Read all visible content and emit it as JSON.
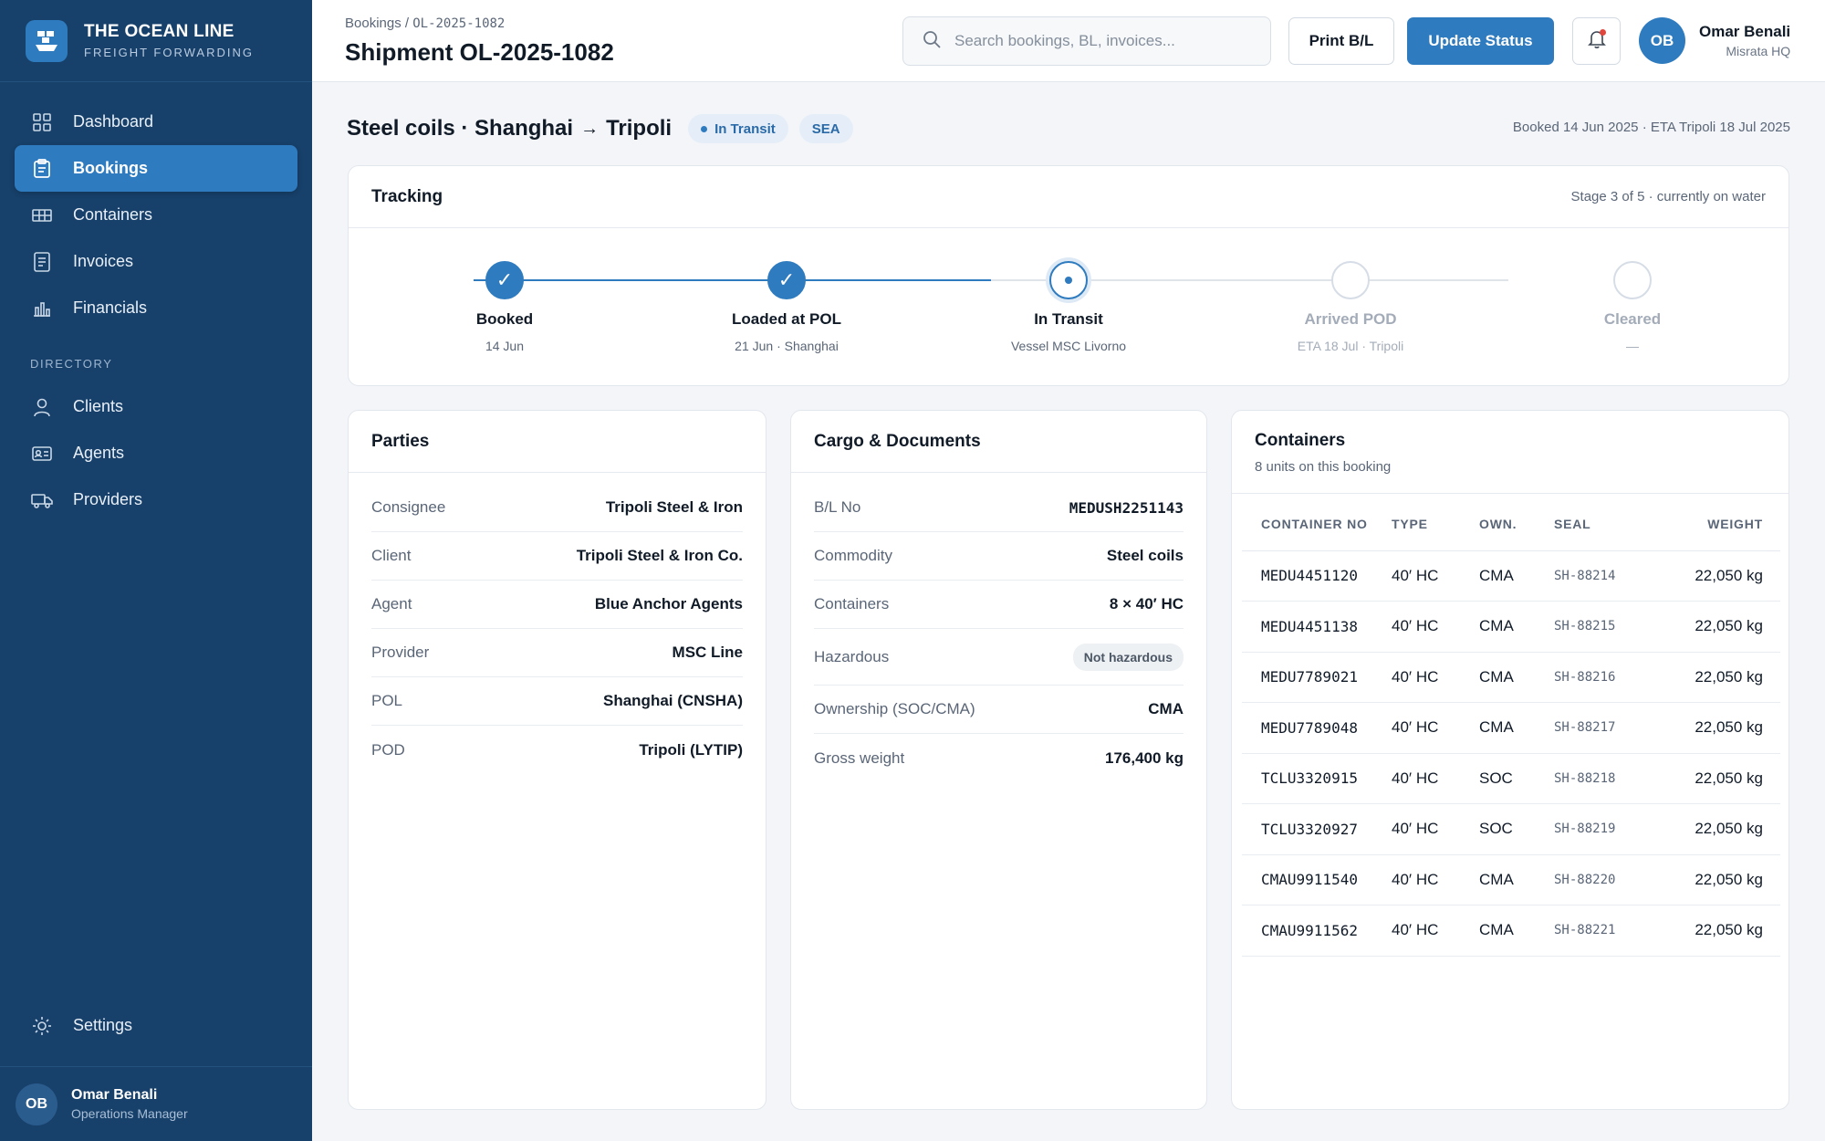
{
  "brand": {
    "name": "THE OCEAN LINE",
    "tagline": "FREIGHT FORWARDING"
  },
  "sidebar": {
    "items": [
      {
        "label": "Dashboard",
        "icon": "grid-icon",
        "active": false
      },
      {
        "label": "Bookings",
        "icon": "clipboard-icon",
        "active": true
      },
      {
        "label": "Containers",
        "icon": "container-icon",
        "active": false
      },
      {
        "label": "Invoices",
        "icon": "document-icon",
        "active": false
      },
      {
        "label": "Financials",
        "icon": "bar-chart-icon",
        "active": false
      }
    ],
    "section_label": "DIRECTORY",
    "directory": [
      {
        "label": "Clients",
        "icon": "person-icon"
      },
      {
        "label": "Agents",
        "icon": "id-card-icon"
      },
      {
        "label": "Providers",
        "icon": "truck-icon"
      }
    ],
    "settings_label": "Settings",
    "user": {
      "initials": "OB",
      "name": "Omar Benali",
      "role": "Operations Manager"
    }
  },
  "header": {
    "breadcrumb_root": "Bookings /",
    "breadcrumb_id": "OL-2025-1082",
    "title": "Shipment OL-2025-1082",
    "search_placeholder": "Search bookings, BL, invoices...",
    "print_label": "Print B/L",
    "update_label": "Update Status",
    "user": {
      "initials": "OB",
      "name": "Omar Benali",
      "location": "Misrata HQ"
    }
  },
  "shipment": {
    "route_from": "Steel coils · Shanghai",
    "route_to": "Tripoli",
    "status": "In Transit",
    "mode": "SEA",
    "booked_info": "Booked 14 Jun 2025 · ETA Tripoli 18 Jul 2025"
  },
  "tracking": {
    "title": "Tracking",
    "stage_text": "Stage 3 of 5 · currently on water",
    "steps": [
      {
        "label": "Booked",
        "sub": "14 Jun",
        "state": "done"
      },
      {
        "label": "Loaded at POL",
        "sub": "21 Jun · Shanghai",
        "state": "done"
      },
      {
        "label": "In Transit",
        "sub": "Vessel MSC Livorno",
        "state": "current"
      },
      {
        "label": "Arrived POD",
        "sub": "ETA 18 Jul · Tripoli",
        "state": "todo"
      },
      {
        "label": "Cleared",
        "sub": "—",
        "state": "todo"
      }
    ]
  },
  "parties": {
    "title": "Parties",
    "rows": [
      {
        "k": "Consignee",
        "v": "Tripoli Steel & Iron"
      },
      {
        "k": "Client",
        "v": "Tripoli Steel & Iron Co."
      },
      {
        "k": "Agent",
        "v": "Blue Anchor Agents"
      },
      {
        "k": "Provider",
        "v": "MSC Line"
      },
      {
        "k": "POL",
        "v": "Shanghai (CNSHA)"
      },
      {
        "k": "POD",
        "v": "Tripoli (LYTIP)"
      }
    ]
  },
  "cargo": {
    "title": "Cargo & Documents",
    "bl_label": "B/L No",
    "bl_value": "MEDUSH2251143",
    "commodity_label": "Commodity",
    "commodity_value": "Steel coils",
    "containers_label": "Containers",
    "containers_value": "8 × 40′ HC",
    "hazardous_label": "Hazardous",
    "hazardous_value": "Not hazardous",
    "ownership_label": "Ownership (SOC/CMA)",
    "ownership_value": "CMA",
    "weight_label": "Gross weight",
    "weight_value": "176,400 kg"
  },
  "containers": {
    "title": "Containers",
    "subtitle": "8 units on this booking",
    "columns": [
      "CONTAINER NO",
      "TYPE",
      "OWN.",
      "SEAL",
      "WEIGHT"
    ],
    "rows": [
      {
        "no": "MEDU4451120",
        "type": "40′ HC",
        "own": "CMA",
        "seal": "SH-88214",
        "weight": "22,050 kg"
      },
      {
        "no": "MEDU4451138",
        "type": "40′ HC",
        "own": "CMA",
        "seal": "SH-88215",
        "weight": "22,050 kg"
      },
      {
        "no": "MEDU7789021",
        "type": "40′ HC",
        "own": "CMA",
        "seal": "SH-88216",
        "weight": "22,050 kg"
      },
      {
        "no": "MEDU7789048",
        "type": "40′ HC",
        "own": "CMA",
        "seal": "SH-88217",
        "weight": "22,050 kg"
      },
      {
        "no": "TCLU3320915",
        "type": "40′ HC",
        "own": "SOC",
        "seal": "SH-88218",
        "weight": "22,050 kg"
      },
      {
        "no": "TCLU3320927",
        "type": "40′ HC",
        "own": "SOC",
        "seal": "SH-88219",
        "weight": "22,050 kg"
      },
      {
        "no": "CMAU9911540",
        "type": "40′ HC",
        "own": "CMA",
        "seal": "SH-88220",
        "weight": "22,050 kg"
      },
      {
        "no": "CMAU9911562",
        "type": "40′ HC",
        "own": "CMA",
        "seal": "SH-88221",
        "weight": "22,050 kg"
      }
    ]
  },
  "colors": {
    "sidebar": "#17406a",
    "accent": "#2f7bbf",
    "background": "#f3f5f8",
    "alert": "#e0463c"
  }
}
